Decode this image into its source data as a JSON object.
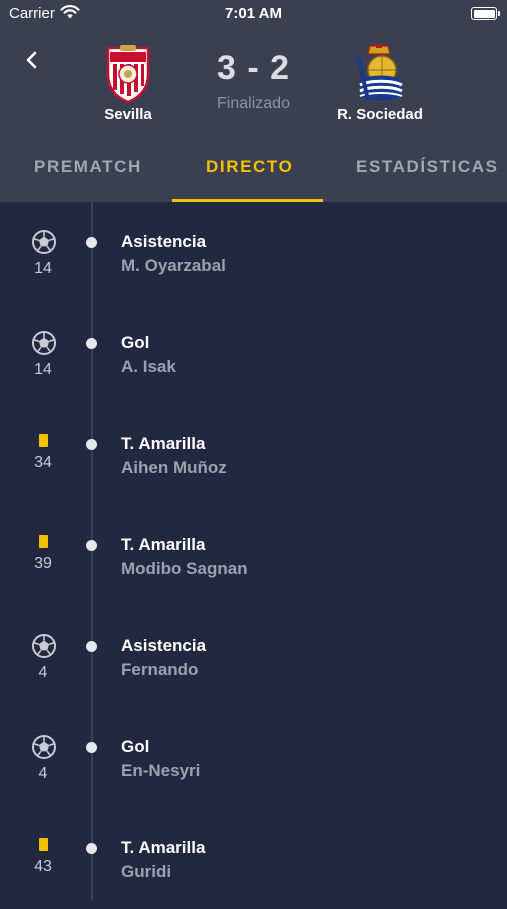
{
  "status_bar": {
    "carrier": "Carrier",
    "time": "7:01 AM"
  },
  "match": {
    "home_team": "Sevilla",
    "away_team": "R. Sociedad",
    "score": "3 - 2",
    "status": "Finalizado"
  },
  "tabs": [
    {
      "label": "PREMATCH",
      "active": false
    },
    {
      "label": "DIRECTO",
      "active": true
    },
    {
      "label": "ESTADÍSTICAS",
      "active": false
    }
  ],
  "colors": {
    "accent": "#f2c200",
    "header_bg": "#3b3f4f",
    "body_bg": "#222840"
  },
  "events": [
    {
      "kind": "ball-icon",
      "minute": "14",
      "type": "Asistencia",
      "player": "M. Oyarzabal"
    },
    {
      "kind": "ball-icon",
      "minute": "14",
      "type": "Gol",
      "player": "A. Isak"
    },
    {
      "kind": "yellow-card-icon",
      "minute": "34",
      "type": "T. Amarilla",
      "player": "Aihen Muñoz"
    },
    {
      "kind": "yellow-card-icon",
      "minute": "39",
      "type": "T. Amarilla",
      "player": "Modibo Sagnan"
    },
    {
      "kind": "ball-icon",
      "minute": "4",
      "type": "Asistencia",
      "player": "Fernando"
    },
    {
      "kind": "ball-icon",
      "minute": "4",
      "type": "Gol",
      "player": "En-Nesyri"
    },
    {
      "kind": "yellow-card-icon",
      "minute": "43",
      "type": "T. Amarilla",
      "player": "Guridi"
    }
  ]
}
